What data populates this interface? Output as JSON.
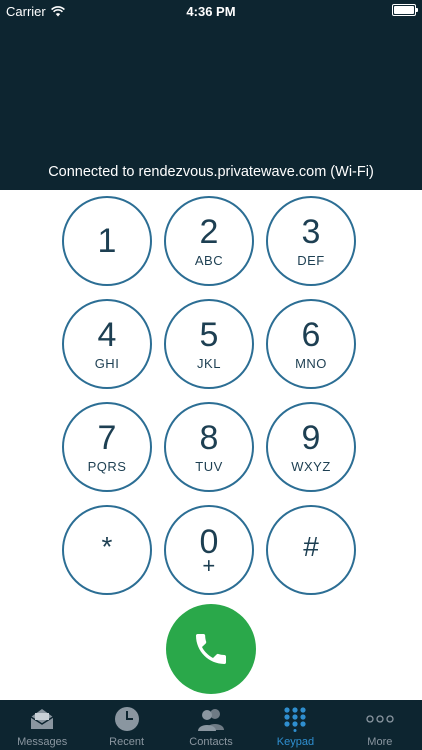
{
  "status_bar": {
    "carrier": "Carrier",
    "time": "4:36 PM"
  },
  "connection": {
    "text": "Connected to rendezvous.privatewave.com (Wi-Fi)"
  },
  "keypad": {
    "keys": [
      {
        "digit": "1",
        "letters": ""
      },
      {
        "digit": "2",
        "letters": "ABC"
      },
      {
        "digit": "3",
        "letters": "DEF"
      },
      {
        "digit": "4",
        "letters": "GHI"
      },
      {
        "digit": "5",
        "letters": "JKL"
      },
      {
        "digit": "6",
        "letters": "MNO"
      },
      {
        "digit": "7",
        "letters": "PQRS"
      },
      {
        "digit": "8",
        "letters": "TUV"
      },
      {
        "digit": "9",
        "letters": "WXYZ"
      },
      {
        "digit": "*",
        "letters": ""
      },
      {
        "digit": "0",
        "letters": "+"
      },
      {
        "digit": "#",
        "letters": ""
      }
    ]
  },
  "tabs": [
    {
      "label": "Messages",
      "icon": "envelope-icon"
    },
    {
      "label": "Recent",
      "icon": "clock-icon"
    },
    {
      "label": "Contacts",
      "icon": "contacts-icon"
    },
    {
      "label": "Keypad",
      "icon": "keypad-icon",
      "active": true
    },
    {
      "label": "More",
      "icon": "more-icon"
    }
  ],
  "colors": {
    "header_bg": "#0d2530",
    "key_border": "#2c6e94",
    "key_text": "#1d3f52",
    "call_button": "#2aa84a",
    "active_tab": "#2f8fd0",
    "inactive_tab": "#8a96a0"
  }
}
